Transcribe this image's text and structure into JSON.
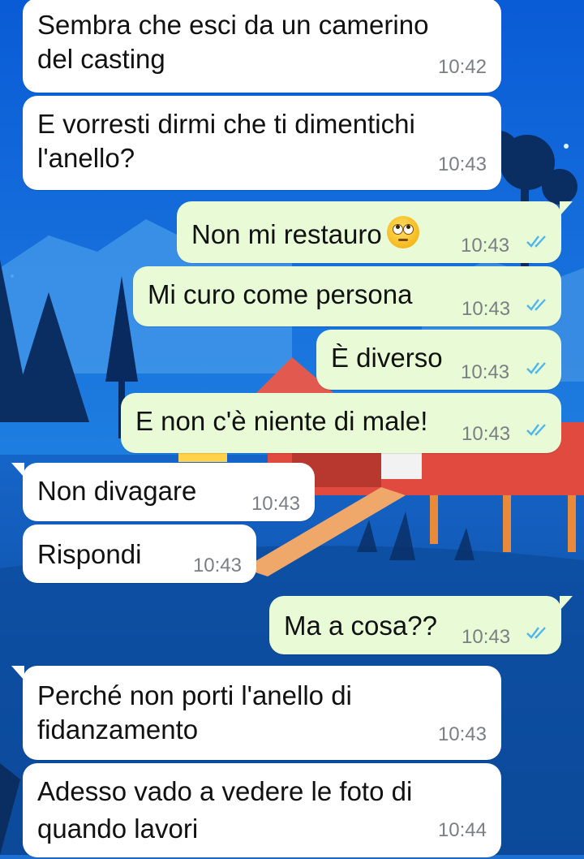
{
  "colors": {
    "incoming_bubble": "#ffffff",
    "outgoing_bubble": "#e8fbd6",
    "timestamp": "#7b7f83",
    "read_ticks": "#4fb6ec",
    "wallpaper_sky": "#1d6fd1"
  },
  "messages": [
    {
      "direction": "in",
      "text_lines": [
        "Sembra che esci da un camerino",
        "del casting"
      ],
      "time": "10:42"
    },
    {
      "direction": "in",
      "text_lines": [
        "E vorresti dirmi che ti dimentichi",
        "l'anello?"
      ],
      "time": "10:43"
    },
    {
      "direction": "out",
      "text": "Non mi restauro",
      "emoji": "face-with-rolling-eyes",
      "time": "10:43",
      "status": "read"
    },
    {
      "direction": "out",
      "text": "Mi curo come persona",
      "time": "10:43",
      "status": "read"
    },
    {
      "direction": "out",
      "text": "È diverso",
      "time": "10:43",
      "status": "read"
    },
    {
      "direction": "out",
      "text": "E non c'è niente di male!",
      "time": "10:43",
      "status": "read"
    },
    {
      "direction": "in",
      "text": "Non divagare",
      "time": "10:43"
    },
    {
      "direction": "in",
      "text": "Rispondi",
      "time": "10:43"
    },
    {
      "direction": "out",
      "text": "Ma a cosa??",
      "time": "10:43",
      "status": "read"
    },
    {
      "direction": "in",
      "text_lines": [
        "Perché non porti l'anello di",
        "fidanzamento"
      ],
      "time": "10:43"
    },
    {
      "direction": "in",
      "text_lines": [
        "Adesso vado a vedere le foto di",
        "quando lavori"
      ],
      "time": "10:44"
    }
  ]
}
